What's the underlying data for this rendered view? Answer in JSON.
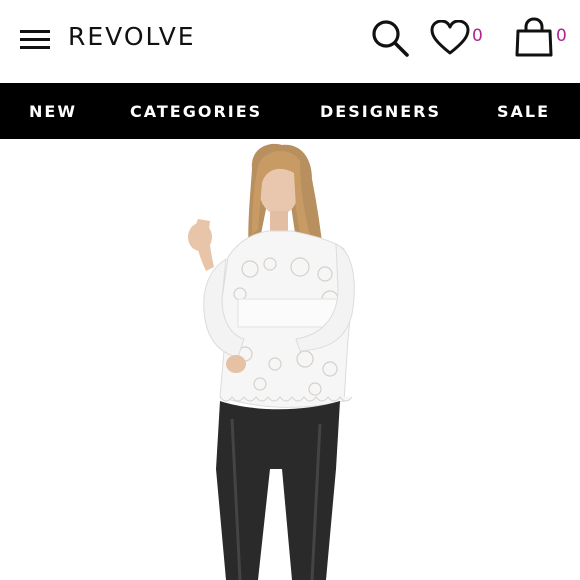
{
  "header": {
    "logo": "REVOLVE",
    "wishlist_count": "0",
    "bag_count": "0",
    "icons": [
      "hamburger-menu-icon",
      "search-icon",
      "heart-icon",
      "shopping-bag-icon"
    ]
  },
  "nav": {
    "items": [
      {
        "label": "NEW"
      },
      {
        "label": "CATEGORIES"
      },
      {
        "label": "DESIGNERS"
      },
      {
        "label": "SALE"
      }
    ]
  },
  "colors": {
    "nav_background": "#000000",
    "count_accent": "#b2248c",
    "logo": "#111111"
  }
}
